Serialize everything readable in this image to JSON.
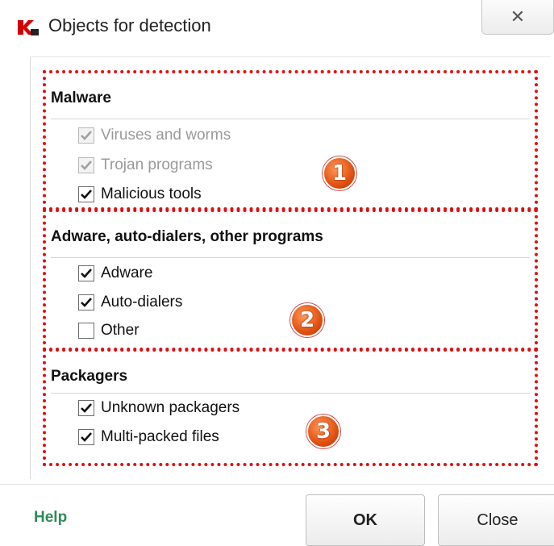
{
  "window": {
    "title": "Objects for detection",
    "close_glyph": "✕"
  },
  "sections": [
    {
      "header": "Malware",
      "options": [
        {
          "label": "Viruses and worms",
          "checked": true,
          "enabled": false
        },
        {
          "label": "Trojan programs",
          "checked": true,
          "enabled": false
        },
        {
          "label": "Malicious tools",
          "checked": true,
          "enabled": true
        }
      ],
      "badge": "1"
    },
    {
      "header": "Adware, auto-dialers, other programs",
      "options": [
        {
          "label": "Adware",
          "checked": true,
          "enabled": true
        },
        {
          "label": "Auto-dialers",
          "checked": true,
          "enabled": true
        },
        {
          "label": "Other",
          "checked": false,
          "enabled": true
        }
      ],
      "badge": "2"
    },
    {
      "header": "Packagers",
      "options": [
        {
          "label": "Unknown packagers",
          "checked": true,
          "enabled": true
        },
        {
          "label": "Multi-packed files",
          "checked": true,
          "enabled": true
        }
      ],
      "badge": "3"
    }
  ],
  "footer": {
    "help_label": "Help",
    "ok_label": "OK",
    "close_label": "Close"
  },
  "colors": {
    "highlight_border": "#dd1111",
    "help_link": "#2e8b57",
    "badge": "#e2500f"
  },
  "icons": {
    "app": "kaspersky-logo-icon",
    "check": "checkmark-icon"
  }
}
